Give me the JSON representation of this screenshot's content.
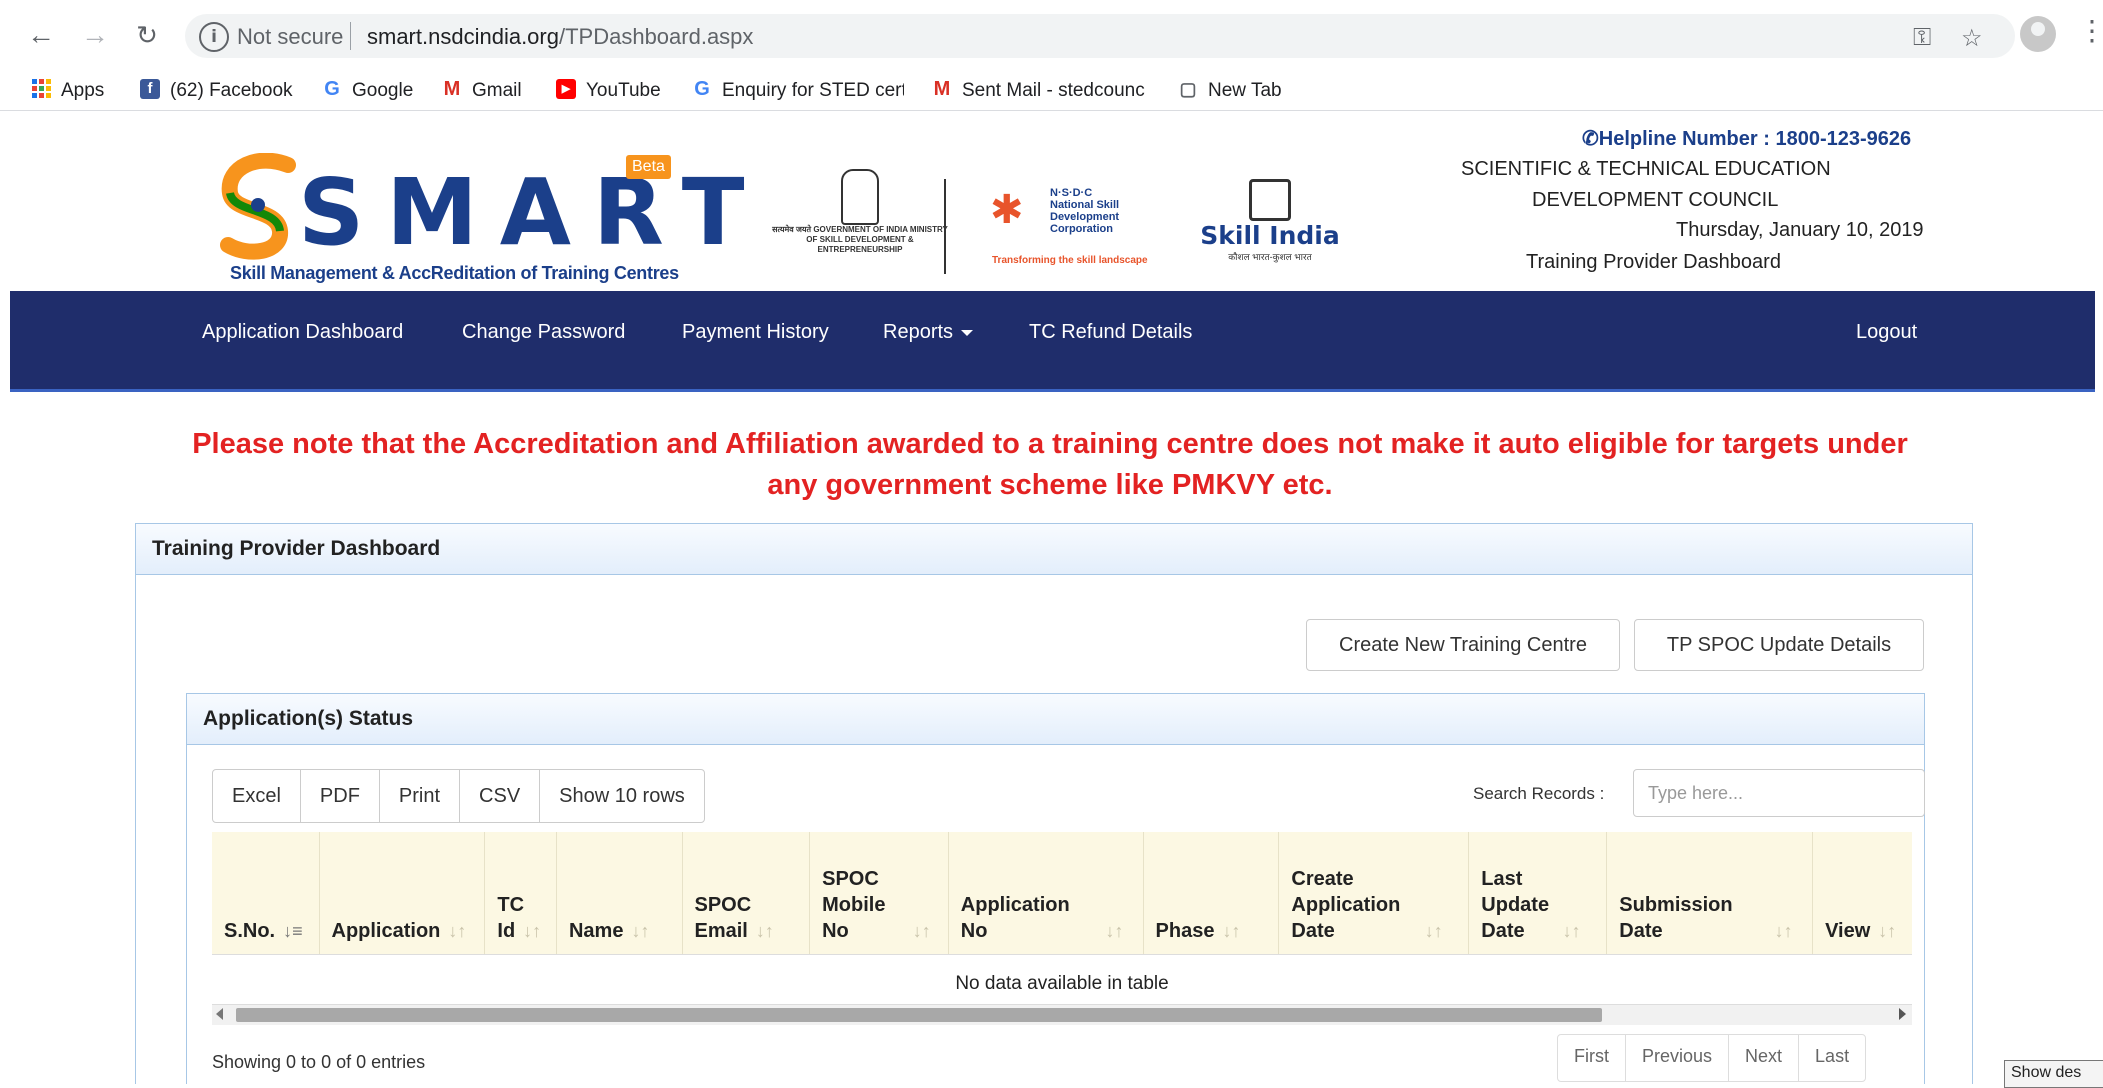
{
  "browser": {
    "security_label": "Not secure",
    "url_domain": "smart.nsdcindia.org",
    "url_path": "/TPDashboard.aspx",
    "bookmarks": [
      {
        "label": "Apps",
        "icon": "apps-grid-icon"
      },
      {
        "label": "(62) Facebook",
        "icon": "facebook-icon",
        "icon_glyph": "f",
        "color": "#3b5998"
      },
      {
        "label": "Google",
        "icon": "google-icon",
        "icon_glyph": "G",
        "color": "#4285f4"
      },
      {
        "label": "Gmail",
        "icon": "gmail-icon",
        "icon_glyph": "M",
        "color": "#d93025"
      },
      {
        "label": "YouTube",
        "icon": "youtube-icon",
        "icon_glyph": "▶",
        "color": "#ff0000"
      },
      {
        "label": "Enquiry for STED cert",
        "icon": "google-icon",
        "icon_glyph": "G",
        "color": "#4285f4"
      },
      {
        "label": "Sent Mail - stedcounc",
        "icon": "gmail-icon",
        "icon_glyph": "M",
        "color": "#d93025"
      },
      {
        "label": "New Tab",
        "icon": "page-icon",
        "icon_glyph": "▢",
        "color": "#5f6368"
      }
    ]
  },
  "header": {
    "logo_letters": "SMART",
    "logo_beta": "Beta",
    "logo_tagline": "Skill Management & AccReditation of Training Centres",
    "emblem_text": "सत्यमेव जयते GOVERNMENT OF INDIA MINISTRY OF SKILL DEVELOPMENT & ENTREPRENEURSHIP",
    "nsdc_abbr": "N·S·D·C",
    "nsdc_name": "National Skill Development Corporation",
    "nsdc_tagline": "Transforming the skill landscape",
    "skill_india": "Skill India",
    "skill_india_sub": "कौशल भारत-कुशल भारत",
    "helpline": "Helpline Number : 1800-123-9626",
    "council_line1": "SCIENTIFIC & TECHNICAL EDUCATION",
    "council_line2": "DEVELOPMENT COUNCIL",
    "date": "Thursday, January 10, 2019",
    "dashboard_label": "Training Provider Dashboard"
  },
  "nav": {
    "application_dashboard": "Application Dashboard",
    "change_password": "Change Password",
    "payment_history": "Payment History",
    "reports": "Reports",
    "tc_refund": "TC Refund Details",
    "logout": "Logout"
  },
  "notice": {
    "line1": "Please note that the Accreditation and Affiliation awarded to a training centre does not make it auto eligible for targets under",
    "line2": "any government scheme like PMKVY etc."
  },
  "panel": {
    "title": "Training Provider Dashboard",
    "create_tc": "Create New Training Centre",
    "spoc_update": "TP SPOC Update Details"
  },
  "status": {
    "title": "Application(s) Status",
    "export_buttons": [
      "Excel",
      "PDF",
      "Print",
      "CSV",
      "Show 10 rows"
    ],
    "search_label": "Search Records :",
    "search_placeholder": "Type here...",
    "columns": [
      {
        "l1": "",
        "l2": "",
        "l3": "S.No."
      },
      {
        "l1": "",
        "l2": "",
        "l3": "Application"
      },
      {
        "l1": "",
        "l2": "TC",
        "l3": "Id"
      },
      {
        "l1": "",
        "l2": "",
        "l3": "Name"
      },
      {
        "l1": "",
        "l2": "SPOC",
        "l3": "Email"
      },
      {
        "l1": "SPOC",
        "l2": "Mobile",
        "l3": "No"
      },
      {
        "l1": "",
        "l2": "Application",
        "l3": "No"
      },
      {
        "l1": "",
        "l2": "",
        "l3": "Phase"
      },
      {
        "l1": "Create",
        "l2": "Application",
        "l3": "Date"
      },
      {
        "l1": "Last",
        "l2": "Update",
        "l3": "Date"
      },
      {
        "l1": "",
        "l2": "Submission",
        "l3": "Date"
      },
      {
        "l1": "",
        "l2": "",
        "l3": "View"
      }
    ],
    "empty_message": "No data available in table",
    "entries_info": "Showing 0 to 0 of 0 entries",
    "pager": [
      "First",
      "Previous",
      "Next",
      "Last"
    ]
  },
  "taskbar": {
    "show_desktop": "Show des"
  }
}
